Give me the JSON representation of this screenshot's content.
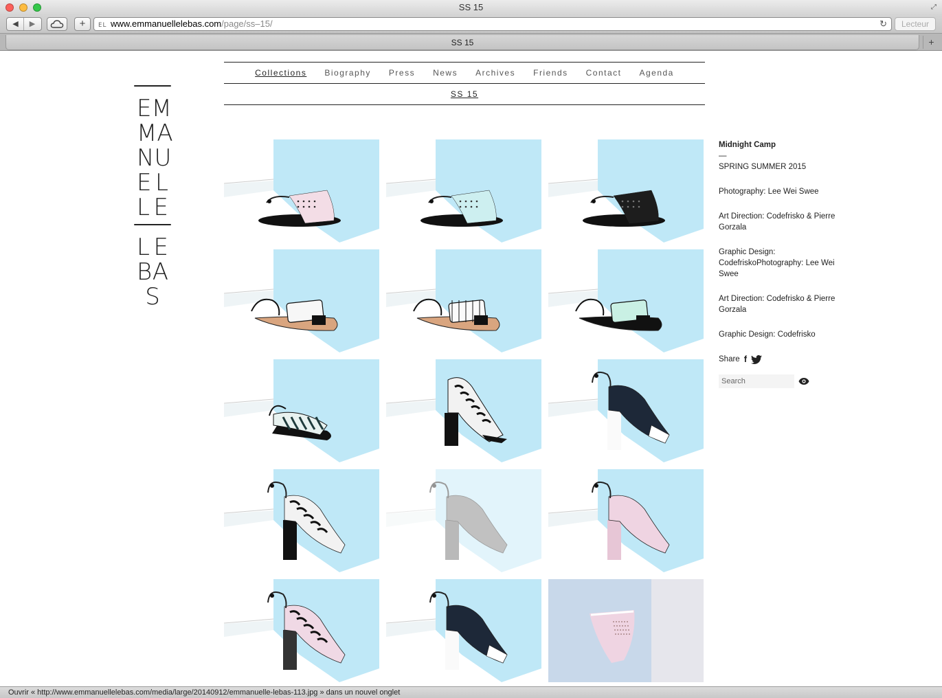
{
  "window": {
    "title": "SS 15"
  },
  "toolbar": {
    "back_icon": "back-arrow-icon",
    "forward_icon": "forward-arrow-icon",
    "icloud_icon": "cloud-icon",
    "add_icon": "plus-icon",
    "url_host": "www.emmanuellelebas.com",
    "url_path": "/page/ss–15/",
    "favicon_text": "EL",
    "reader_label": "Lecteur"
  },
  "tab": {
    "label": "SS 15"
  },
  "logo": {
    "line1": [
      "E",
      "M"
    ],
    "line2": [
      "M",
      "A"
    ],
    "line3": [
      "N",
      "U"
    ],
    "line4": [
      "E",
      "L"
    ],
    "line5": [
      "L",
      "E"
    ],
    "line6": [
      "L",
      "E"
    ],
    "line7": [
      "B",
      "A"
    ],
    "line8": [
      "S"
    ]
  },
  "nav": {
    "items": [
      "Collections",
      "Biography",
      "Press",
      "News",
      "Archives",
      "Friends",
      "Contact",
      "Agenda"
    ],
    "active": "Collections",
    "sub": "SS 15"
  },
  "gallery": {
    "items": [
      {
        "shoe": "flat-sandal",
        "print": "marble-pink"
      },
      {
        "shoe": "flat-sandal",
        "print": "mint-perforated"
      },
      {
        "shoe": "flat-sandal",
        "print": "black-perforated"
      },
      {
        "shoe": "strap-flat",
        "print": "white-black"
      },
      {
        "shoe": "strap-flat",
        "print": "grid"
      },
      {
        "shoe": "strap-flat",
        "print": "mint-black"
      },
      {
        "shoe": "wedge-sandal",
        "print": "marble-green"
      },
      {
        "shoe": "heel-bootie",
        "print": "marble-black"
      },
      {
        "shoe": "heel-mule",
        "print": "navy-white"
      },
      {
        "shoe": "heel-sandal",
        "print": "marble-black"
      },
      {
        "shoe": "heel-pump",
        "print": "grey-faded"
      },
      {
        "shoe": "heel-pump",
        "print": "pink"
      },
      {
        "shoe": "heel-mule",
        "print": "pink-marble"
      },
      {
        "shoe": "heel-mule",
        "print": "navy-white"
      },
      {
        "shoe": "perforated-mule",
        "print": "pink"
      }
    ]
  },
  "sidebar": {
    "collection": "Midnight Camp",
    "dash": "—",
    "season": "SPRING SUMMER 2015",
    "credits": [
      "Photography: Lee Wei Swee",
      "Art Direction: Codefrisko & Pierre Gorzala",
      "Graphic Design: CodefriskoPhotography: Lee Wei Swee",
      "Art Direction: Codefrisko & Pierre Gorzala",
      "Graphic Design: Codefrisko"
    ],
    "share_label": "Share",
    "facebook": "f",
    "twitter_icon": "twitter-bird-icon",
    "search_placeholder": "Search",
    "search_icon": "eye-icon"
  },
  "statusbar": {
    "text": "Ouvrir « http://www.emmanuellelebas.com/media/large/20140912/emmanuelle-lebas-113.jpg » dans un nouvel onglet"
  },
  "colors": {
    "studio_blue": "#bfe8f7",
    "text": "#222222",
    "nav_gray": "#555555"
  }
}
